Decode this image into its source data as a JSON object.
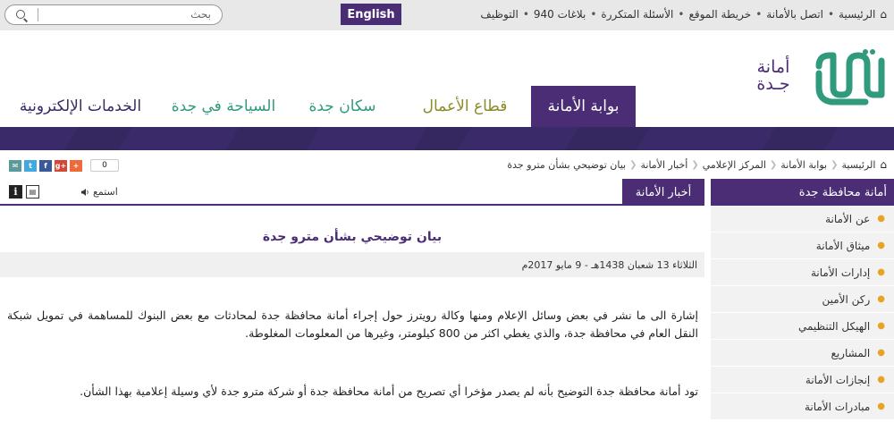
{
  "topbar": {
    "links": [
      "الرئيسية",
      "اتصل بالأمانة",
      "خريطة الموقع",
      "الأسئلة المتكررة",
      "بلاغات 940",
      "التوظيف"
    ],
    "english_label": "English",
    "search_placeholder": "بحث"
  },
  "logo": {
    "line1": "أمانة",
    "line2": "جـدة"
  },
  "nav": {
    "tabs": [
      "بوابة الأمانة",
      "قطاع الأعمال",
      "سكان جدة",
      "السياحة في جدة",
      "الخدمات الإلكترونية"
    ]
  },
  "breadcrumb": [
    "الرئيسية",
    "بوابة الأمانة",
    "المركز الإعلامي",
    "أخبار الأمانة",
    "بيان توضيحي بشأن مترو جدة"
  ],
  "share": {
    "count": "0"
  },
  "sidebar": {
    "title": "أمانة محافظة جدة",
    "items": [
      "عن الأمانة",
      "ميثاق الأمانة",
      "إدارات الأمانة",
      "ركن الأمين",
      "الهيكل التنظيمي",
      "المشاريع",
      "إنجازات الأمانة",
      "مبادرات الأمانة"
    ]
  },
  "content": {
    "section": "أخبار الأمانة",
    "listen_label": "استمع",
    "title": "بيان توضيحي بشأن مترو جدة",
    "date": "الثلاثاء 13 شعبان 1438هـ - 9 مايو 2017م",
    "paragraphs": [
      "إشارة الى ما نشر في بعض وسائل الإعلام ومنها وكالة رويترز حول إجراء أمانة محافظة جدة لمحادثات مع بعض البنوك للمساهمة في تمويل شبكة النقل العام في محافظة جدة، والذي يغطي اكثر من 800 كيلومتر، وغيرها من المعلومات المغلوطة.",
      "تود أمانة محافظة جدة التوضيح بأنه لم يصدر مؤخرا أي تصريح من أمانة محافظة جدة أو شركة مترو جدة لأي وسيلة إعلامية بهذا الشأن."
    ]
  },
  "colors": {
    "brand_purple": "#4a2d74",
    "nav_green": "#2f9a7c",
    "nav_olive": "#8a8a27",
    "bullet_orange": "#e8a323"
  }
}
